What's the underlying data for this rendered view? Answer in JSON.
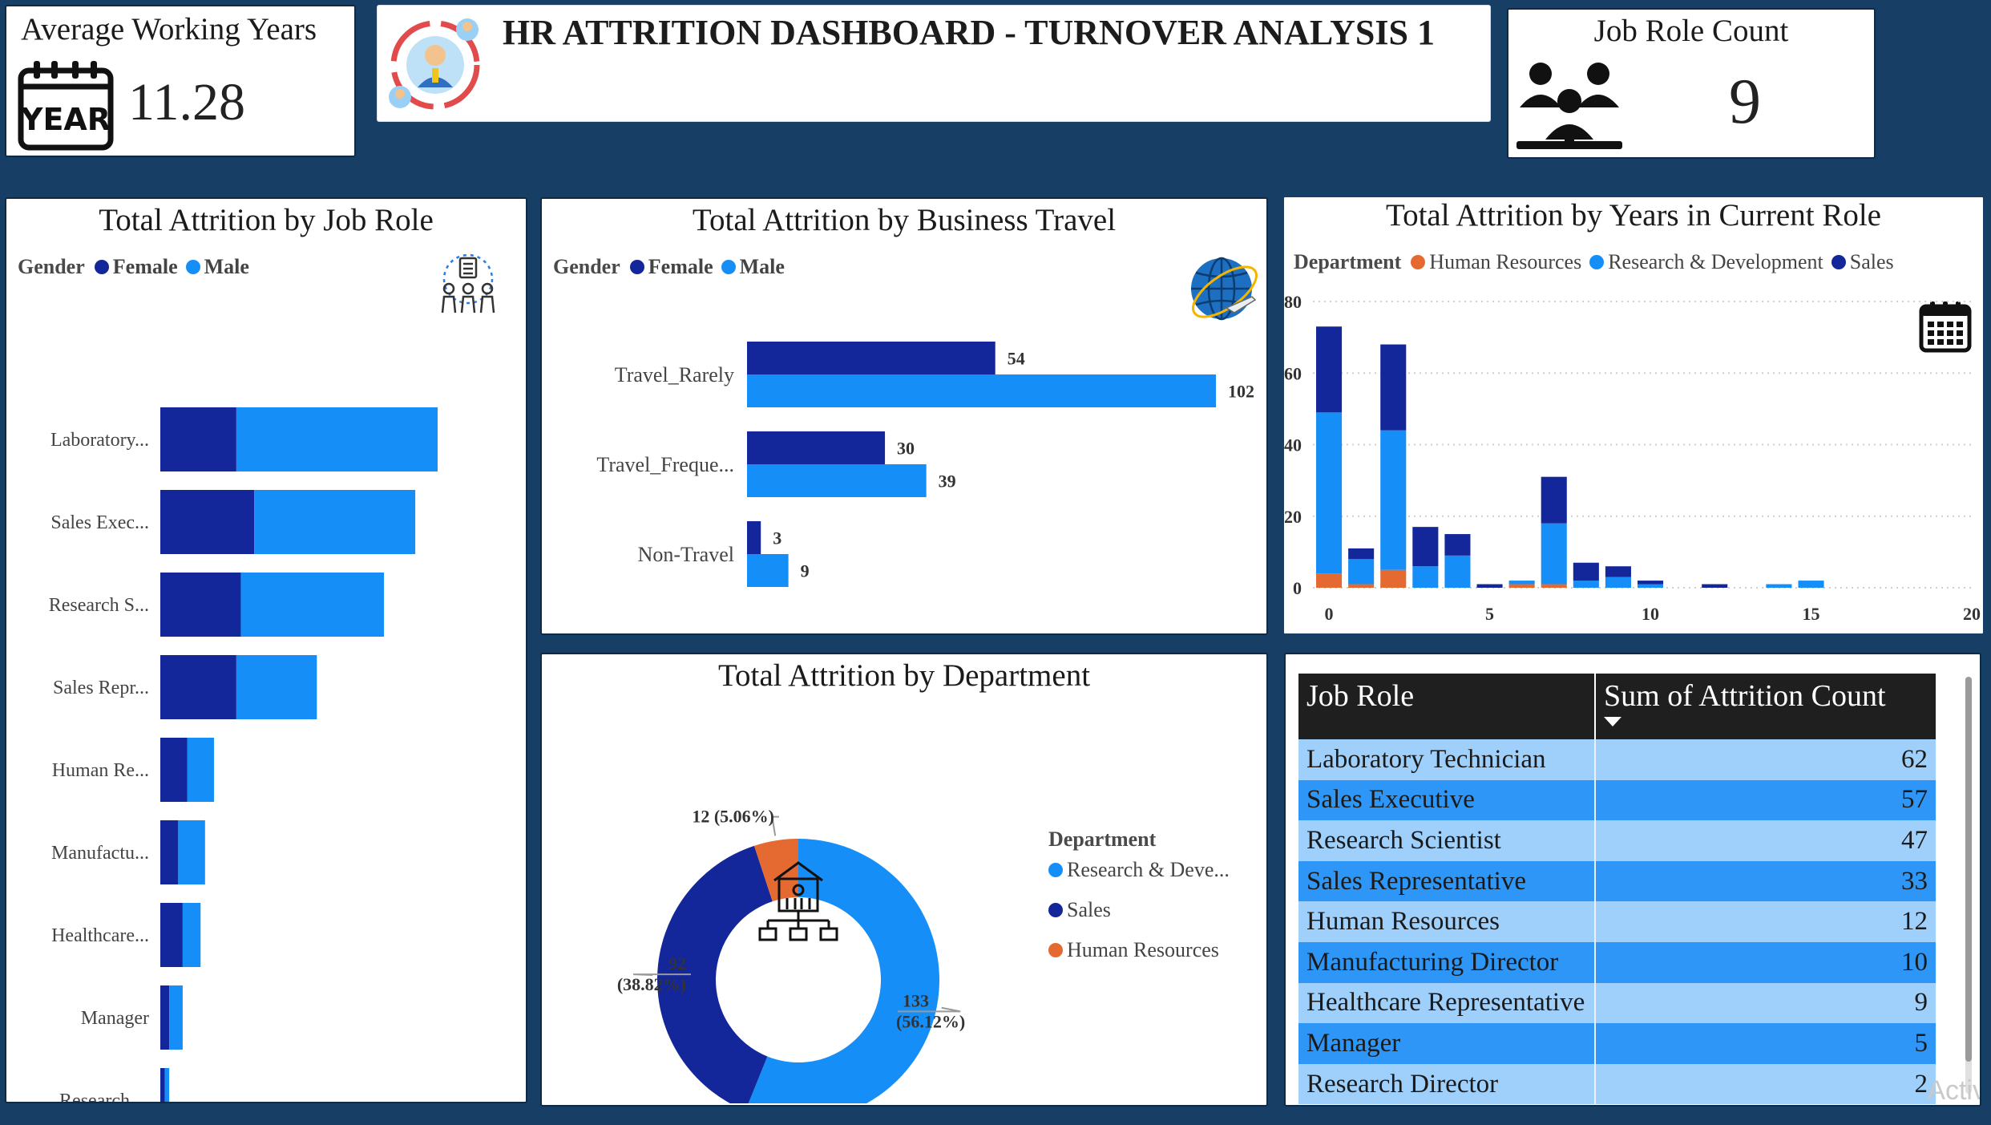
{
  "kpis": {
    "avg_years": {
      "label": "Average Working Years",
      "value": "11.28",
      "icon": "calendar-year-icon",
      "icon_text": "YEAR"
    },
    "job_role_count": {
      "label": "Job Role Count",
      "value": "9",
      "icon": "people-group-icon"
    }
  },
  "header": {
    "title": "HR ATTRITION DASHBOARD - TURNOVER ANALYSIS 1",
    "icon": "employee-cycle-icon"
  },
  "colors": {
    "female": "#13279a",
    "male": "#168ef7",
    "hr": "#e46a32",
    "rd": "#168ef7",
    "sales": "#13279a",
    "background": "#173f66"
  },
  "legends": {
    "gender": {
      "title": "Gender",
      "female": "Female",
      "male": "Male"
    },
    "department": {
      "title": "Department",
      "hr": "Human Resources",
      "rd": "Research & Development",
      "sales": "Sales",
      "rd_short": "Research & Deve..."
    }
  },
  "chart_data": [
    {
      "id": "job_role",
      "type": "bar",
      "orientation": "horizontal",
      "stacked": true,
      "title": "Total Attrition by Job Role",
      "categories": [
        "Laboratory...",
        "Sales Exec...",
        "Research S...",
        "Sales Repr...",
        "Human Re...",
        "Manufactu...",
        "Healthcare...",
        "Manager",
        "Research ..."
      ],
      "series": [
        {
          "name": "Female",
          "values": [
            17,
            21,
            18,
            17,
            6,
            4,
            5,
            2,
            1
          ]
        },
        {
          "name": "Male",
          "values": [
            45,
            36,
            32,
            18,
            6,
            6,
            4,
            3,
            1
          ]
        }
      ],
      "xlim": [
        0,
        62
      ],
      "legend": "top-left",
      "icon": "workforce-icon"
    },
    {
      "id": "business_travel",
      "type": "bar",
      "orientation": "horizontal",
      "title": "Total Attrition by Business Travel",
      "categories": [
        "Travel_Rarely",
        "Travel_Freque...",
        "Non-Travel"
      ],
      "series": [
        {
          "name": "Female",
          "values": [
            54,
            30,
            3
          ]
        },
        {
          "name": "Male",
          "values": [
            102,
            39,
            9
          ]
        }
      ],
      "xlim": [
        0,
        102
      ],
      "legend": "top-left",
      "icon": "globe-plane-icon"
    },
    {
      "id": "years_in_role",
      "type": "bar",
      "stacked": true,
      "title": "Total Attrition by Years in Current Role",
      "x": [
        0,
        1,
        2,
        3,
        4,
        5,
        6,
        7,
        8,
        9,
        10,
        11,
        12,
        13,
        14,
        15,
        16,
        17,
        18,
        19,
        20
      ],
      "series": [
        {
          "name": "Human Resources",
          "values": [
            4,
            1,
            5,
            0,
            0,
            0,
            1,
            1,
            0,
            0,
            0,
            0,
            0,
            0,
            0,
            0,
            0,
            0,
            0,
            0,
            0
          ]
        },
        {
          "name": "Research & Development",
          "values": [
            45,
            7,
            39,
            6,
            9,
            0,
            1,
            17,
            2,
            3,
            1,
            0,
            0,
            0,
            1,
            2,
            0,
            0,
            0,
            0,
            0
          ]
        },
        {
          "name": "Sales",
          "values": [
            24,
            3,
            24,
            11,
            6,
            1,
            0,
            13,
            5,
            3,
            1,
            0,
            1,
            0,
            0,
            0,
            0,
            0,
            0,
            0,
            0
          ]
        }
      ],
      "xticks": [
        0,
        5,
        10,
        15,
        20
      ],
      "yticks": [
        0,
        20,
        40,
        60,
        80
      ],
      "xlim": [
        -0.5,
        20
      ],
      "ylim": [
        0,
        80
      ],
      "legend": "top",
      "icon": "calendar-icon"
    },
    {
      "id": "department",
      "type": "pie",
      "donut": true,
      "title": "Total Attrition by Department",
      "slices": [
        {
          "name": "Research & Development",
          "value": 133,
          "label_value": "133",
          "label_pct": "(56.12%)"
        },
        {
          "name": "Sales",
          "value": 92,
          "label_value": "92",
          "label_pct": "(38.82%)"
        },
        {
          "name": "Human Resources",
          "value": 12,
          "label_value": "12",
          "label_pct": "(5.06%)"
        }
      ],
      "legend_title": "Department",
      "legend_items": [
        "Research & Deve...",
        "Sales",
        "Human Resources"
      ],
      "legend": "right",
      "icon": "organization-structure-icon"
    },
    {
      "id": "job_role_table",
      "type": "table",
      "columns": [
        "Job Role",
        "Sum of Attrition Count"
      ],
      "sort": "descending",
      "rows": [
        [
          "Laboratory Technician",
          "62"
        ],
        [
          "Sales Executive",
          "57"
        ],
        [
          "Research Scientist",
          "47"
        ],
        [
          "Sales Representative",
          "33"
        ],
        [
          "Human Resources",
          "12"
        ],
        [
          "Manufacturing Director",
          "10"
        ],
        [
          "Healthcare Representative",
          "9"
        ],
        [
          "Manager",
          "5"
        ],
        [
          "Research Director",
          "2"
        ]
      ]
    }
  ],
  "watermark": "Activ"
}
